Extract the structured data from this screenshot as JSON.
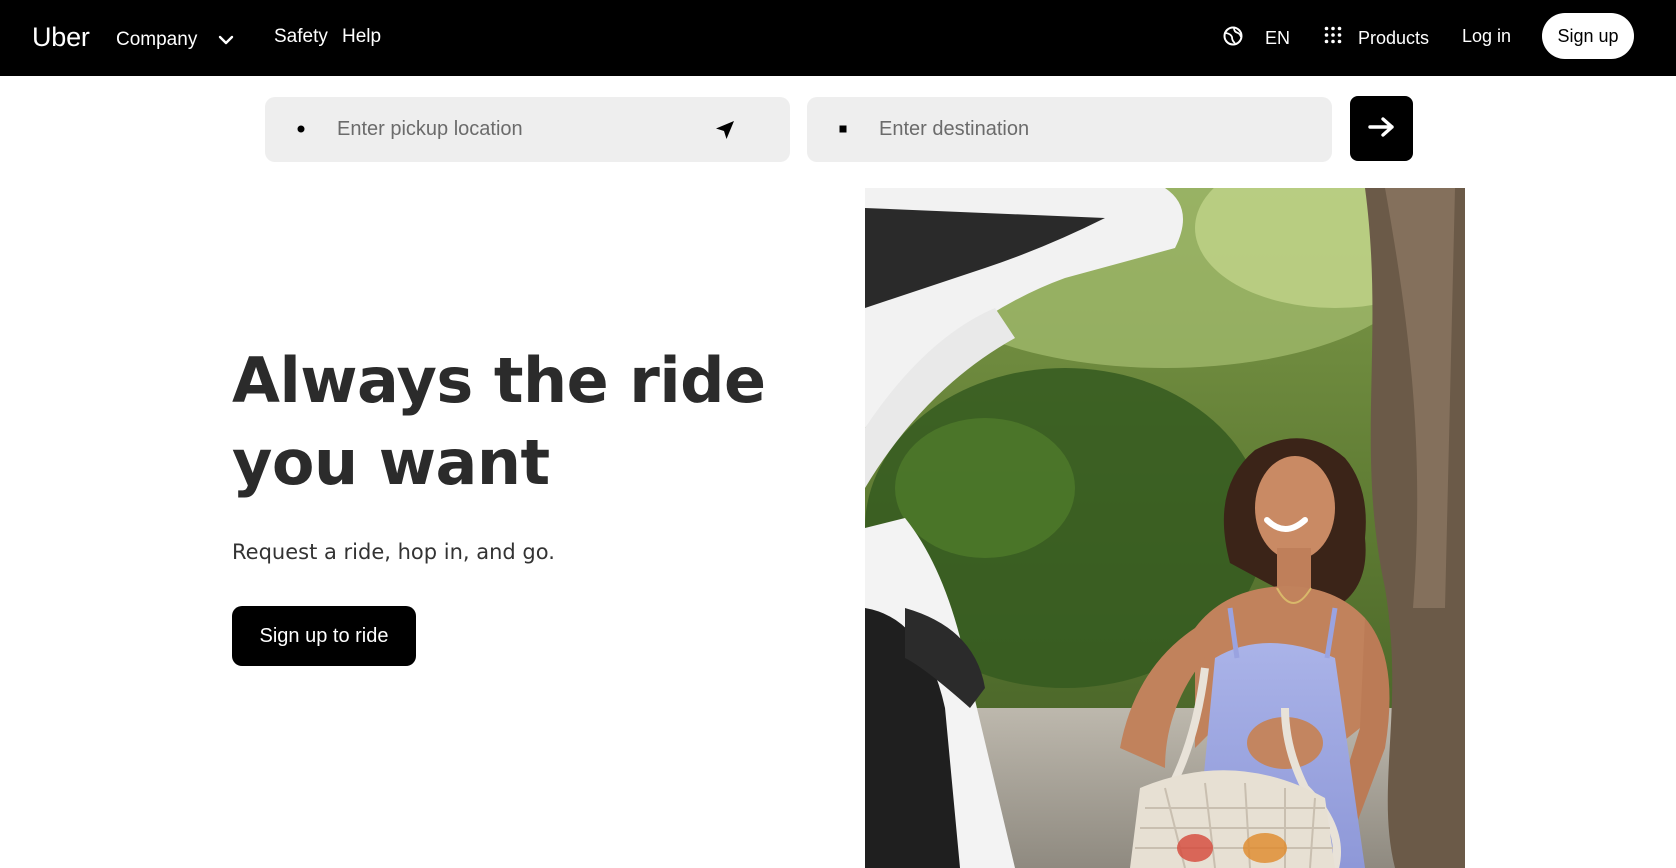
{
  "nav": {
    "brand": "Uber",
    "company": "Company",
    "safety": "Safety",
    "help": "Help",
    "language": "EN",
    "products": "Products",
    "login": "Log in",
    "signup": "Sign up"
  },
  "search": {
    "pickup_placeholder": "Enter pickup location",
    "pickup_value": "",
    "destination_placeholder": "Enter destination",
    "destination_value": ""
  },
  "hero": {
    "title": "Always the ride you want",
    "subtitle": "Request a ride, hop in, and go.",
    "cta": "Sign up to ride"
  },
  "icons": {
    "company_dropdown": "chevron-down-icon",
    "language": "globe-icon",
    "products": "grid-dots-icon",
    "pickup_marker": "dot-icon",
    "current_location": "location-arrow-icon",
    "destination_marker": "square-icon",
    "submit": "arrow-right-icon"
  },
  "colors": {
    "nav_background": "#000000",
    "field_background": "#eeeeee",
    "primary_button": "#000000",
    "heading_text": "#2b2b2b"
  }
}
